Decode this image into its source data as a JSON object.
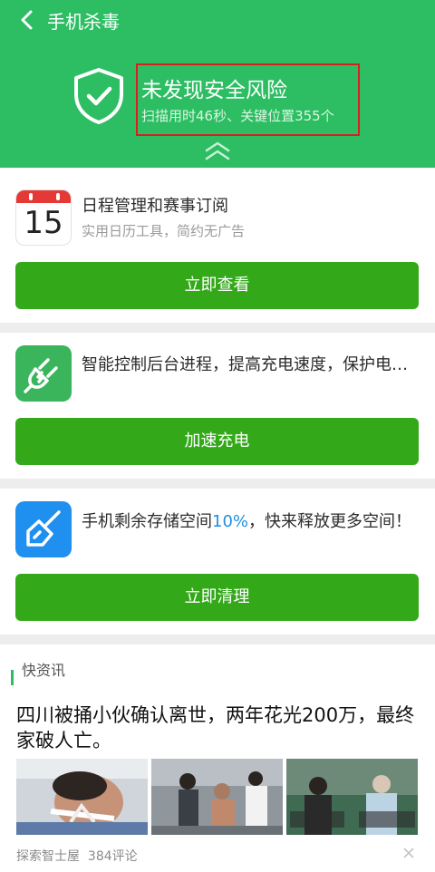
{
  "header": {
    "title": "手机杀毒",
    "status_title": "未发现安全风险",
    "status_sub": "扫描用时46秒、关键位置355个"
  },
  "cards": [
    {
      "calendar_day": "15",
      "title": "日程管理和赛事订阅",
      "subtitle": "实用日历工具，简约无广告",
      "button": "立即查看"
    },
    {
      "icon": "plug-icon",
      "title": "智能控制后台进程，提高充电速度，保护电…",
      "button": "加速充电"
    },
    {
      "icon": "broom-icon",
      "title_pre": "手机剩余存储空间",
      "title_num": "10%",
      "title_post": "，快来释放更多空间！",
      "button": "立即清理"
    }
  ],
  "news": {
    "label": "快资讯",
    "headline": "四川被捅小伙确认离世，两年花光200万，最终家破人亡。",
    "source": "探索智士屋",
    "comments": "384评论"
  },
  "colors": {
    "header_green": "#2dbe63",
    "button_green": "#33a91a",
    "highlight_red": "#d81f1f",
    "accent_blue": "#1e8fe0"
  }
}
